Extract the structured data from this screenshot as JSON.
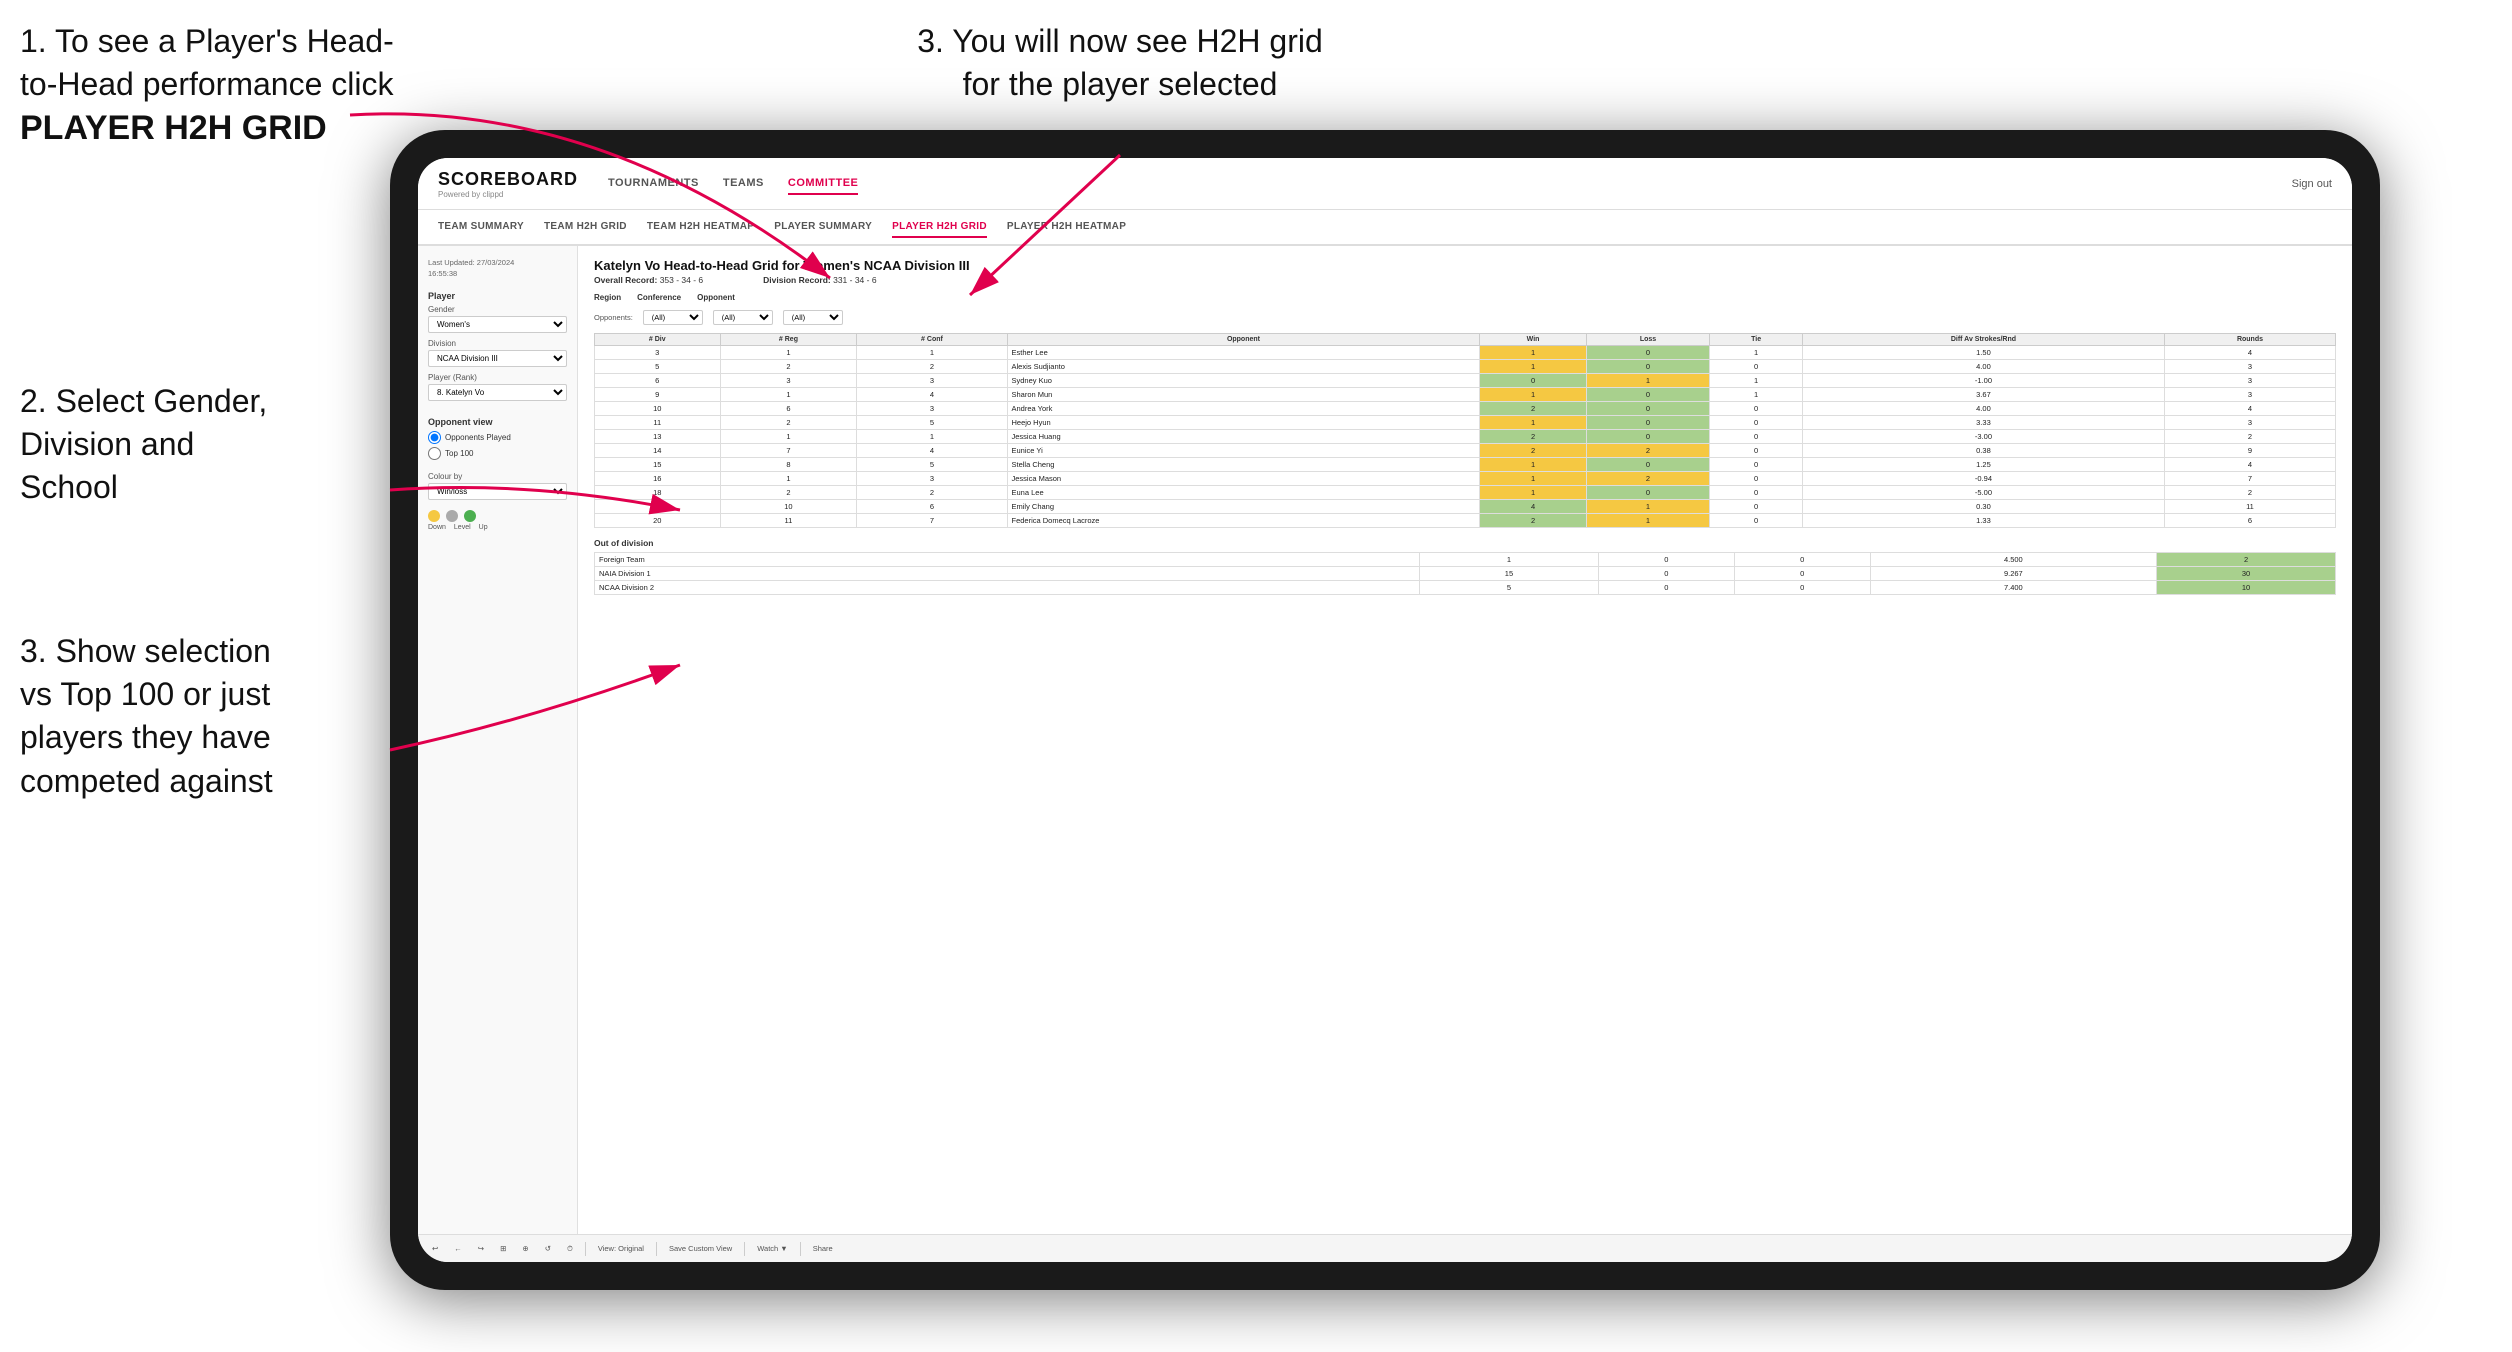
{
  "instructions": {
    "top_left_line1": "1. To see a Player's Head-",
    "top_left_line2": "to-Head performance click",
    "top_left_bold": "PLAYER H2H GRID",
    "top_right": "3. You will now see H2H grid\nfor the player selected",
    "mid_left_line1": "2. Select Gender,",
    "mid_left_line2": "Division and",
    "mid_left_line3": "School",
    "bot_left_line1": "3. Show selection",
    "bot_left_line2": "vs Top 100 or just",
    "bot_left_line3": "players they have",
    "bot_left_line4": "competed against"
  },
  "nav": {
    "logo": "SCOREBOARD",
    "logo_sub": "Powered by clippd",
    "links": [
      "TOURNAMENTS",
      "TEAMS",
      "COMMITTEE"
    ],
    "active_link": "COMMITTEE",
    "sign_out": "Sign out"
  },
  "sub_nav": {
    "links": [
      "TEAM SUMMARY",
      "TEAM H2H GRID",
      "TEAM H2H HEATMAP",
      "PLAYER SUMMARY",
      "PLAYER H2H GRID",
      "PLAYER H2H HEATMAP"
    ],
    "active": "PLAYER H2H GRID"
  },
  "sidebar": {
    "timestamp": "Last Updated: 27/03/2024\n16:55:38",
    "player_section": "Player",
    "gender_label": "Gender",
    "gender_value": "Women's",
    "division_label": "Division",
    "division_value": "NCAA Division III",
    "player_rank_label": "Player (Rank)",
    "player_rank_value": "8. Katelyn Vo",
    "opponent_view_label": "Opponent view",
    "opponent_played": "Opponents Played",
    "top_100": "Top 100",
    "colour_by": "Colour by",
    "colour_value": "Win/loss",
    "colour_down": "Down",
    "colour_level": "Level",
    "colour_up": "Up"
  },
  "grid": {
    "title": "Katelyn Vo Head-to-Head Grid for Women's NCAA Division III",
    "overall_record_label": "Overall Record:",
    "overall_record_value": "353 - 34 - 6",
    "division_record_label": "Division Record:",
    "division_record_value": "331 - 34 - 6",
    "region_label": "Region",
    "conference_label": "Conference",
    "opponent_label": "Opponent",
    "opponents_label": "Opponents:",
    "opponents_value": "(All)",
    "conf_filter_value": "(All)",
    "opp_filter_value": "(All)",
    "columns": [
      "# Div",
      "# Reg",
      "# Conf",
      "Opponent",
      "Win",
      "Loss",
      "Tie",
      "Diff Av Strokes/Rnd",
      "Rounds"
    ],
    "rows": [
      {
        "div": "3",
        "reg": "1",
        "conf": "1",
        "opponent": "Esther Lee",
        "win": "1",
        "loss": "0",
        "tie": "1",
        "diff": "1.50",
        "rounds": "4",
        "win_color": "yellow",
        "loss_color": "green"
      },
      {
        "div": "5",
        "reg": "2",
        "conf": "2",
        "opponent": "Alexis Sudjianto",
        "win": "1",
        "loss": "0",
        "tie": "0",
        "diff": "4.00",
        "rounds": "3",
        "win_color": "yellow",
        "loss_color": "green"
      },
      {
        "div": "6",
        "reg": "3",
        "conf": "3",
        "opponent": "Sydney Kuo",
        "win": "0",
        "loss": "1",
        "tie": "1",
        "diff": "-1.00",
        "rounds": "3",
        "win_color": "green",
        "loss_color": "yellow"
      },
      {
        "div": "9",
        "reg": "1",
        "conf": "4",
        "opponent": "Sharon Mun",
        "win": "1",
        "loss": "0",
        "tie": "1",
        "diff": "3.67",
        "rounds": "3",
        "win_color": "yellow",
        "loss_color": "green"
      },
      {
        "div": "10",
        "reg": "6",
        "conf": "3",
        "opponent": "Andrea York",
        "win": "2",
        "loss": "0",
        "tie": "0",
        "diff": "4.00",
        "rounds": "4",
        "win_color": "green",
        "loss_color": "green"
      },
      {
        "div": "11",
        "reg": "2",
        "conf": "5",
        "opponent": "Heejo Hyun",
        "win": "1",
        "loss": "0",
        "tie": "0",
        "diff": "3.33",
        "rounds": "3",
        "win_color": "yellow",
        "loss_color": "green"
      },
      {
        "div": "13",
        "reg": "1",
        "conf": "1",
        "opponent": "Jessica Huang",
        "win": "2",
        "loss": "0",
        "tie": "0",
        "diff": "-3.00",
        "rounds": "2",
        "win_color": "green",
        "loss_color": "green"
      },
      {
        "div": "14",
        "reg": "7",
        "conf": "4",
        "opponent": "Eunice Yi",
        "win": "2",
        "loss": "2",
        "tie": "0",
        "diff": "0.38",
        "rounds": "9",
        "win_color": "yellow",
        "loss_color": "yellow"
      },
      {
        "div": "15",
        "reg": "8",
        "conf": "5",
        "opponent": "Stella Cheng",
        "win": "1",
        "loss": "0",
        "tie": "0",
        "diff": "1.25",
        "rounds": "4",
        "win_color": "yellow",
        "loss_color": "green"
      },
      {
        "div": "16",
        "reg": "1",
        "conf": "3",
        "opponent": "Jessica Mason",
        "win": "1",
        "loss": "2",
        "tie": "0",
        "diff": "-0.94",
        "rounds": "7",
        "win_color": "yellow",
        "loss_color": "yellow"
      },
      {
        "div": "18",
        "reg": "2",
        "conf": "2",
        "opponent": "Euna Lee",
        "win": "1",
        "loss": "0",
        "tie": "0",
        "diff": "-5.00",
        "rounds": "2",
        "win_color": "yellow",
        "loss_color": "green"
      },
      {
        "div": "19",
        "reg": "10",
        "conf": "6",
        "opponent": "Emily Chang",
        "win": "4",
        "loss": "1",
        "tie": "0",
        "diff": "0.30",
        "rounds": "11",
        "win_color": "green",
        "loss_color": "yellow"
      },
      {
        "div": "20",
        "reg": "11",
        "conf": "7",
        "opponent": "Federica Domecq Lacroze",
        "win": "2",
        "loss": "1",
        "tie": "0",
        "diff": "1.33",
        "rounds": "6",
        "win_color": "green",
        "loss_color": "yellow"
      }
    ],
    "out_of_division_label": "Out of division",
    "out_of_division_rows": [
      {
        "label": "Foreign Team",
        "win": "1",
        "loss": "0",
        "tie": "0",
        "diff": "4.500",
        "rounds": "2"
      },
      {
        "label": "NAIA Division 1",
        "win": "15",
        "loss": "0",
        "tie": "0",
        "diff": "9.267",
        "rounds": "30"
      },
      {
        "label": "NCAA Division 2",
        "win": "5",
        "loss": "0",
        "tie": "0",
        "diff": "7.400",
        "rounds": "10"
      }
    ]
  },
  "toolbar": {
    "buttons": [
      "↩",
      "←",
      "↪",
      "⊞",
      "⊕",
      "↺",
      "⏱",
      "View: Original",
      "Save Custom View",
      "Watch ▼",
      "⊕",
      "≡",
      "Share"
    ]
  }
}
